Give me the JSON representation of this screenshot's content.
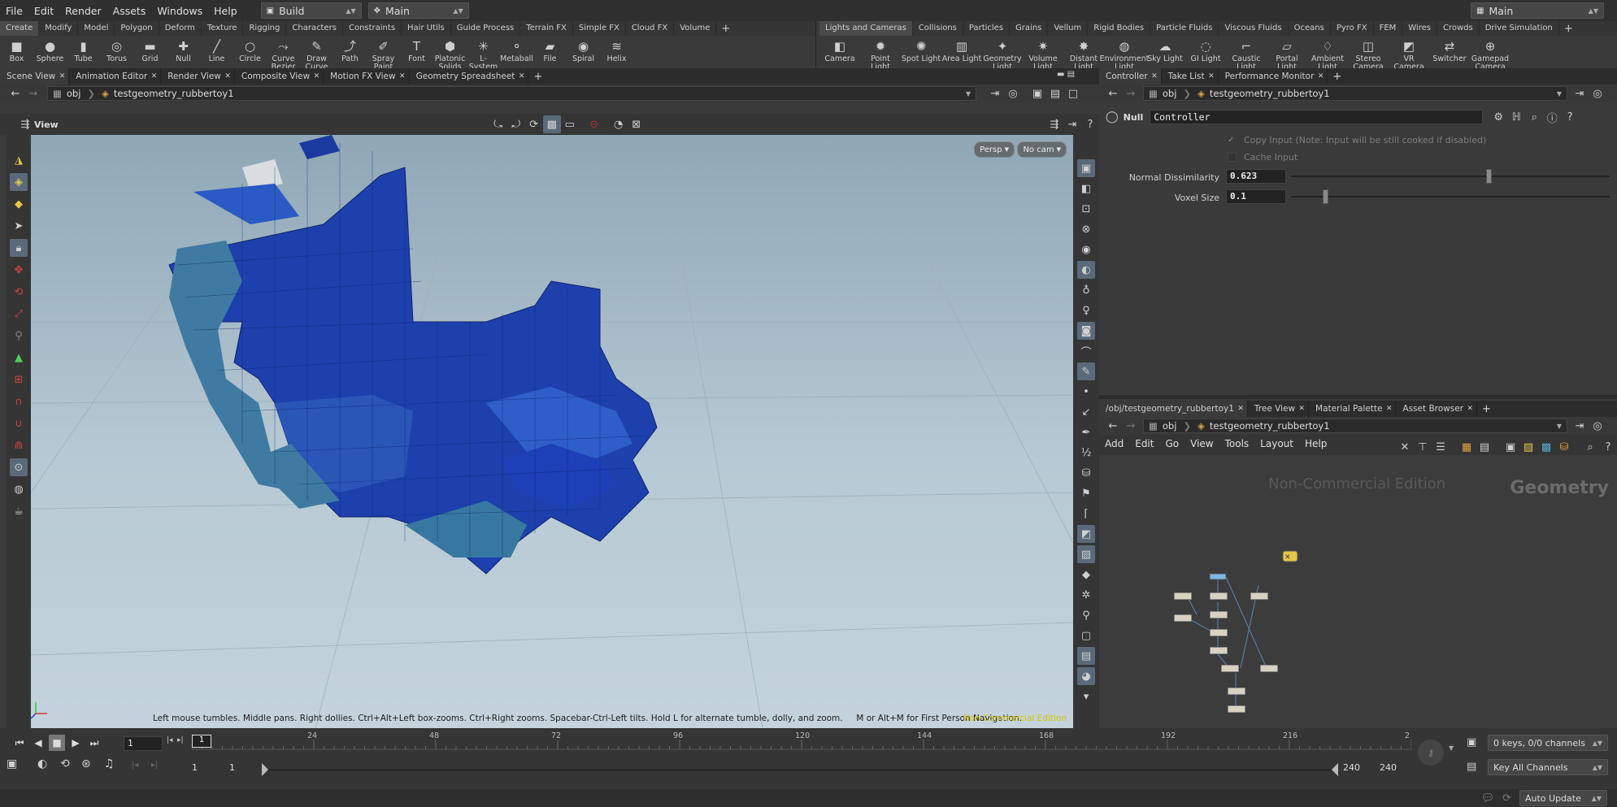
{
  "menubar": {
    "items": [
      "File",
      "Edit",
      "Render",
      "Assets",
      "Windows",
      "Help"
    ],
    "desktop": "Build",
    "network": "Main",
    "right_network": "Main"
  },
  "left_shelf": {
    "tabs": [
      "Create",
      "Modify",
      "Model",
      "Polygon",
      "Deform",
      "Texture",
      "Rigging",
      "Characters",
      "Constraints",
      "Hair Utils",
      "Guide Process",
      "Terrain FX",
      "Simple FX",
      "Cloud FX",
      "Volume"
    ],
    "active_tab": "Create",
    "tools": [
      {
        "label": "Box",
        "icon": "■"
      },
      {
        "label": "Sphere",
        "icon": "●"
      },
      {
        "label": "Tube",
        "icon": "▮"
      },
      {
        "label": "Torus",
        "icon": "◎"
      },
      {
        "label": "Grid",
        "icon": "▬"
      },
      {
        "label": "Null",
        "icon": "✚"
      },
      {
        "label": "Line",
        "icon": "╱"
      },
      {
        "label": "Circle",
        "icon": "○"
      },
      {
        "label": "Curve Bezier",
        "icon": "⤳"
      },
      {
        "label": "Draw Curve",
        "icon": "✎"
      },
      {
        "label": "Path",
        "icon": "⤴"
      },
      {
        "label": "Spray Paint",
        "icon": "✐"
      },
      {
        "label": "Font",
        "icon": "T"
      },
      {
        "label": "Platonic Solids",
        "icon": "⬢"
      },
      {
        "label": "L-System",
        "icon": "✳"
      },
      {
        "label": "Metaball",
        "icon": "⚬"
      },
      {
        "label": "File",
        "icon": "▰"
      },
      {
        "label": "Spiral",
        "icon": "◉"
      },
      {
        "label": "Helix",
        "icon": "≋"
      }
    ]
  },
  "right_shelf": {
    "tabs": [
      "Lights and Cameras",
      "Collisions",
      "Particles",
      "Grains",
      "Vellum",
      "Rigid Bodies",
      "Particle Fluids",
      "Viscous Fluids",
      "Oceans",
      "Pyro FX",
      "FEM",
      "Wires",
      "Crowds",
      "Drive Simulation"
    ],
    "active_tab": "Lights and Cameras",
    "tools": [
      {
        "label": "Camera",
        "icon": "◧"
      },
      {
        "label": "Point Light",
        "icon": "✹"
      },
      {
        "label": "Spot Light",
        "icon": "✺"
      },
      {
        "label": "Area Light",
        "icon": "▥"
      },
      {
        "label": "Geometry Light",
        "icon": "✦"
      },
      {
        "label": "Volume Light",
        "icon": "✷"
      },
      {
        "label": "Distant Light",
        "icon": "✸"
      },
      {
        "label": "Environment Light",
        "icon": "◍"
      },
      {
        "label": "Sky Light",
        "icon": "☁"
      },
      {
        "label": "GI Light",
        "icon": "◌"
      },
      {
        "label": "Caustic Light",
        "icon": "⌐"
      },
      {
        "label": "Portal Light",
        "icon": "▱"
      },
      {
        "label": "Ambient Light",
        "icon": "♢"
      },
      {
        "label": "Stereo Camera",
        "icon": "◫"
      },
      {
        "label": "VR Camera",
        "icon": "◩"
      },
      {
        "label": "Switcher",
        "icon": "⇄"
      },
      {
        "label": "Gamepad Camera",
        "icon": "⊕"
      }
    ]
  },
  "scene_view": {
    "tabs": [
      "Scene View",
      "Animation Editor",
      "Render View",
      "Composite View",
      "Motion FX View",
      "Geometry Spreadsheet"
    ],
    "path_root": "obj",
    "path_node": "testgeometry_rubbertoy1",
    "view_label": "View",
    "persp_label": "Persp",
    "cam_label": "No cam",
    "status_text": "Left mouse tumbles. Middle pans. Right dollies. Ctrl+Alt+Left box-zooms. Ctrl+Right zooms. Spacebar-Ctrl-Left tilts. Hold L for alternate tumble, dolly, and zoom.     M or Alt+M for First Person Navigation.",
    "watermark": "Non-Commercial Edition"
  },
  "parameters": {
    "tabs": [
      "Controller",
      "Take List",
      "Performance Monitor"
    ],
    "path_root": "obj",
    "path_node": "testgeometry_rubbertoy1",
    "node_type": "Null",
    "node_name": "Controller",
    "copy_input": "Copy Input (Note: Input will be still cooked if disabled)",
    "cache_input": "Cache Input",
    "normal_dissimilarity_label": "Normal Dissimilarity",
    "normal_dissimilarity_value": "0.623",
    "normal_dissimilarity_fraction": 0.623,
    "voxel_size_label": "Voxel Size",
    "voxel_size_value": "0.1",
    "voxel_size_fraction": 0.1
  },
  "network": {
    "tabs": [
      "/obj/testgeometry_rubbertoy1",
      "Tree View",
      "Material Palette",
      "Asset Browser"
    ],
    "path_root": "obj",
    "path_node": "testgeometry_rubbertoy1",
    "menu": [
      "Add",
      "Edit",
      "Go",
      "View",
      "Tools",
      "Layout",
      "Help"
    ],
    "watermark": "Non-Commercial Edition",
    "context_label": "Geometry"
  },
  "timeline": {
    "current_frame": "1",
    "frame_marker": "1",
    "ticks": [
      "24",
      "48",
      "72",
      "96",
      "120",
      "144",
      "168",
      "192",
      "216",
      "2"
    ],
    "range_start": "1",
    "range_start2": "1",
    "range_end": "240",
    "range_end2": "240",
    "keys_label": "0 keys, 0/0 channels",
    "key_all": "Key All Channels",
    "auto_update": "Auto Update"
  },
  "colors": {
    "accent": "#5a6a7a",
    "watermark_yellow": "#d8c400",
    "voxel_blue": "#1f45b8"
  }
}
